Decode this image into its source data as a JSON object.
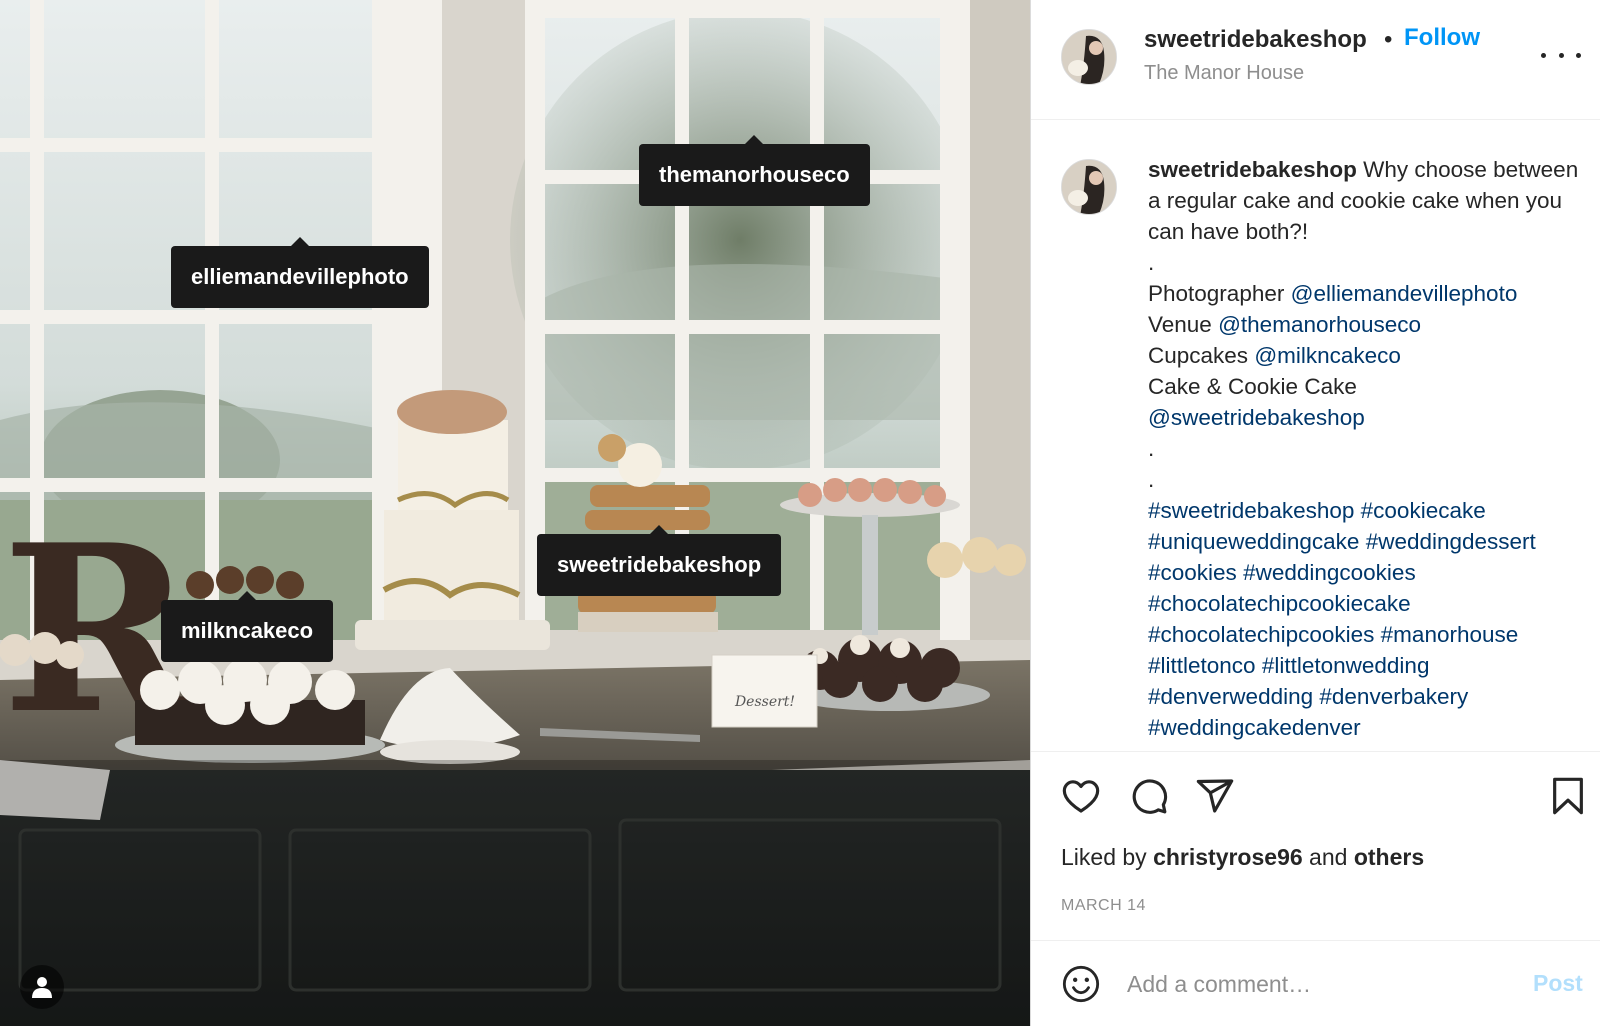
{
  "photo": {
    "tags": {
      "ellie": "elliemandevillephoto",
      "manor": "themanorhouseco",
      "sweet": "sweetridebakeshop",
      "milk": "milkncakeco"
    },
    "letter": "R",
    "sign_text": "Dessert!"
  },
  "header": {
    "username": "sweetridebakeshop",
    "separator": "•",
    "follow_label": "Follow",
    "location": "The Manor House"
  },
  "caption": {
    "username": "sweetridebakeshop",
    "intro": " Why choose between a regular cake and cookie cake when you can have both?!",
    "dot1": ".",
    "photographer_label": "Photographer ",
    "photographer_handle": "@elliemandevillephoto",
    "venue_label": "Venue ",
    "venue_handle": "@themanorhouseco",
    "cupcakes_label": "Cupcakes ",
    "cupcakes_handle": "@milkncakeco",
    "cake_label": "Cake & Cookie Cake",
    "cake_handle": "@sweetridebakeshop",
    "dot2": ".",
    "dot3": ".",
    "hashtags": [
      "#sweetridebakeshop",
      "#cookiecake",
      "#uniqueweddingcake",
      "#weddingdessert",
      "#cookies",
      "#weddingcookies",
      "#chocolatechipcookiecake",
      "#chocolatechipcookies",
      "#manorhouse",
      "#littletonco",
      "#littletonwedding",
      "#denverwedding",
      "#denverbakery",
      "#weddingcakedenver"
    ]
  },
  "engagement": {
    "liked_by_prefix": "Liked by ",
    "liked_by_user": "christyrose96",
    "liked_by_and": " and ",
    "liked_by_others": "others",
    "date": "MARCH 14"
  },
  "comment": {
    "placeholder": "Add a comment…",
    "post_label": "Post"
  },
  "colors": {
    "link_blue": "#0095f6",
    "mention_blue": "#00376b",
    "muted_gray": "#8e8e8e",
    "post_disabled": "#b2dffc"
  },
  "icons": [
    "heart-icon",
    "comment-icon",
    "share-icon",
    "bookmark-icon",
    "emoji-icon",
    "more-icon",
    "user-tag-icon"
  ]
}
